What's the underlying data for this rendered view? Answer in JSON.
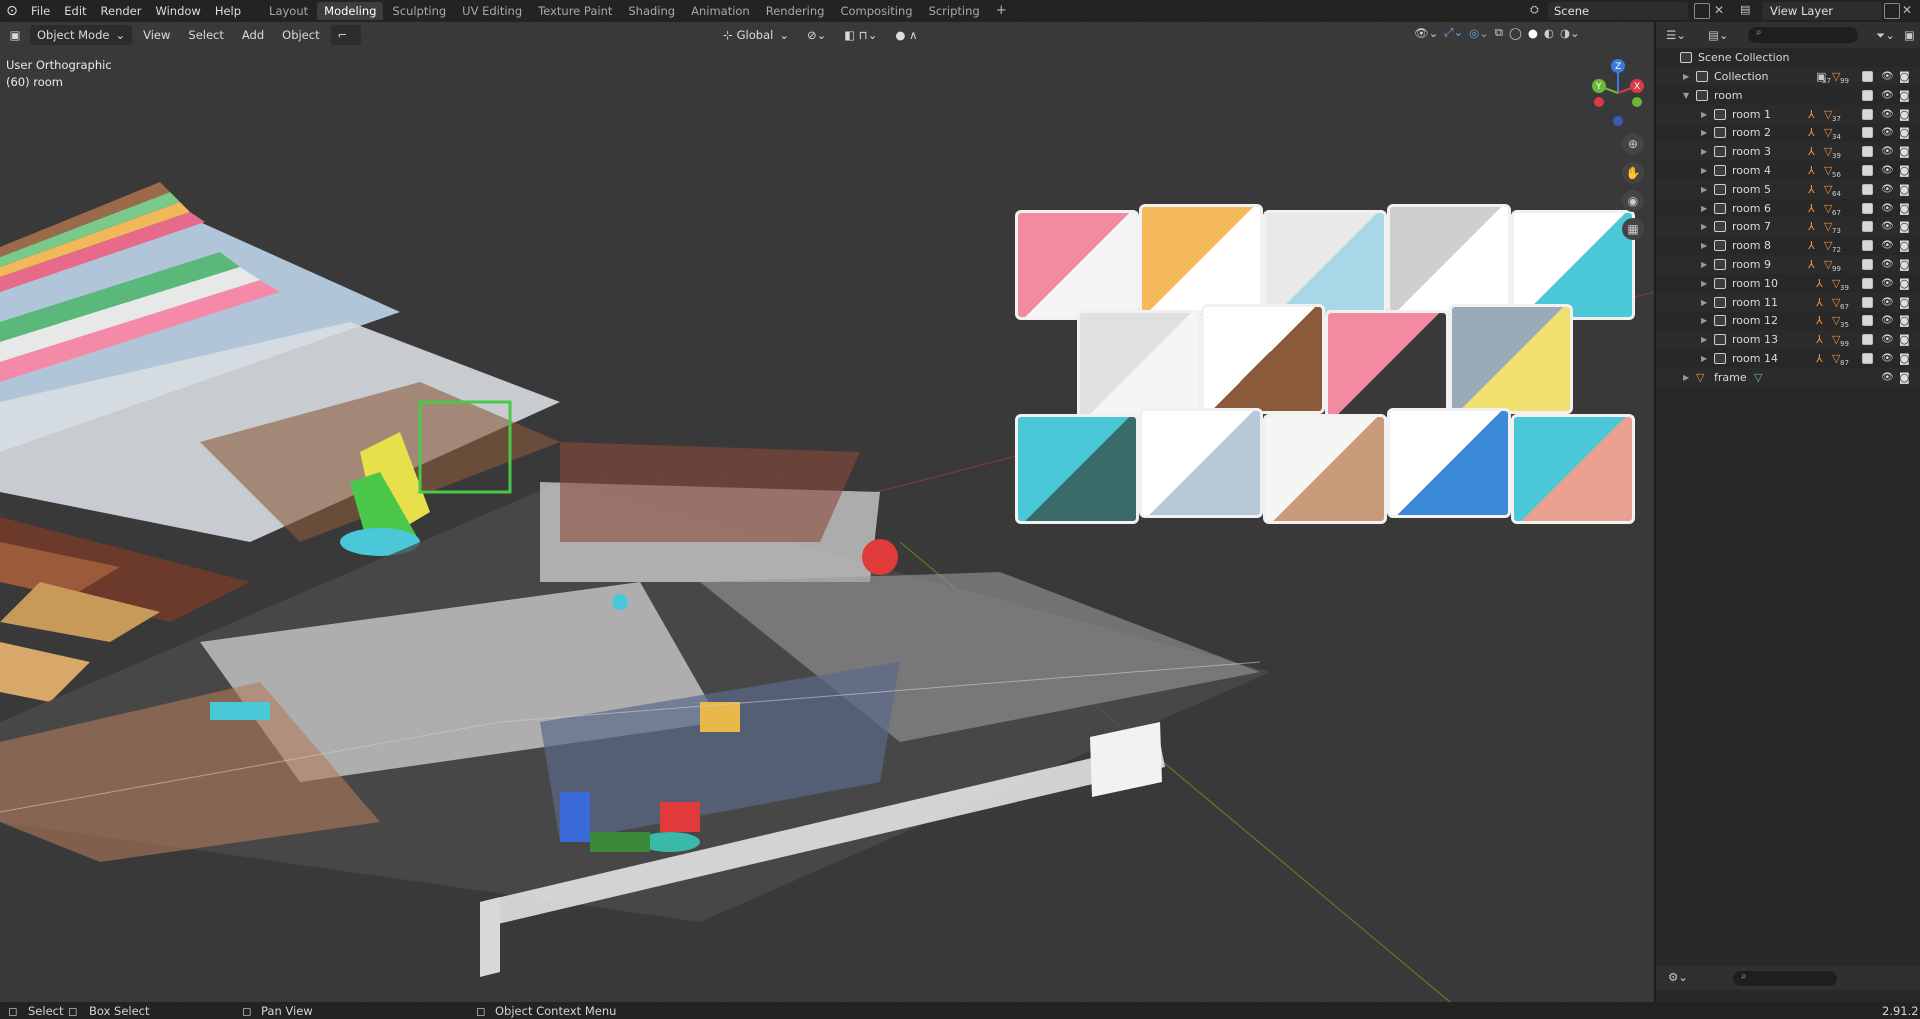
{
  "topbar": {
    "menus": [
      "File",
      "Edit",
      "Render",
      "Window",
      "Help"
    ],
    "workspaces": [
      "Layout",
      "Modeling",
      "Sculpting",
      "UV Editing",
      "Texture Paint",
      "Shading",
      "Animation",
      "Rendering",
      "Compositing",
      "Scripting"
    ],
    "active_workspace": "Modeling",
    "scene_name": "Scene",
    "view_layer": "View Layer"
  },
  "viewport_header": {
    "mode": "Object Mode",
    "menus": [
      "View",
      "Select",
      "Add",
      "Object"
    ],
    "transform_orientation": "Global"
  },
  "viewport": {
    "view_name": "User Orthographic",
    "collection_info": "(60) room",
    "gizmo_axes": [
      "Z",
      "Y",
      "X"
    ]
  },
  "outliner": {
    "root": "Scene Collection",
    "items": [
      {
        "label": "Collection",
        "count": "37",
        "count2": "99",
        "level": 1
      },
      {
        "label": "room",
        "level": 1
      },
      {
        "label": "room 1",
        "count": "37",
        "level": 2
      },
      {
        "label": "room 2",
        "count": "34",
        "level": 2
      },
      {
        "label": "room 3",
        "count": "39",
        "level": 2
      },
      {
        "label": "room 4",
        "count": "56",
        "level": 2
      },
      {
        "label": "room 5",
        "count": "64",
        "level": 2
      },
      {
        "label": "room 6",
        "count": "67",
        "level": 2
      },
      {
        "label": "room 7",
        "count": "73",
        "level": 2
      },
      {
        "label": "room 8",
        "count": "72",
        "level": 2
      },
      {
        "label": "room 9",
        "count": "99",
        "level": 2
      },
      {
        "label": "room 10",
        "count": "39",
        "level": 2
      },
      {
        "label": "room 11",
        "count": "67",
        "level": 2
      },
      {
        "label": "room 12",
        "count": "35",
        "level": 2
      },
      {
        "label": "room 13",
        "count": "99",
        "level": 2
      },
      {
        "label": "room 14",
        "count": "87",
        "level": 2
      },
      {
        "label": "frame",
        "level": 1
      }
    ]
  },
  "statusbar": {
    "select": "Select",
    "box_select": "Box Select",
    "pan_view": "Pan View",
    "context_menu": "Object Context Menu",
    "version": "2.91.2"
  }
}
